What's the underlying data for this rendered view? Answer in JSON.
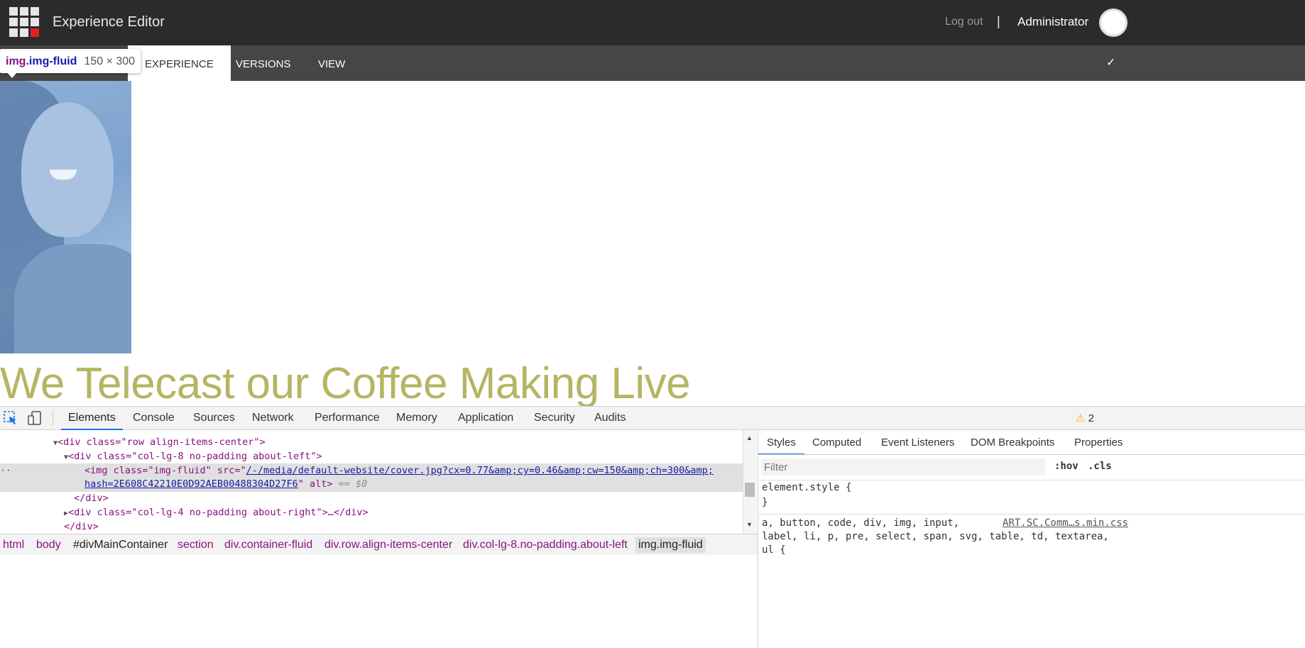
{
  "topbar": {
    "title": "Experience Editor",
    "logout": "Log out",
    "separator": "|",
    "user": "Administrator"
  },
  "ribbon": {
    "tabs": [
      {
        "label": "EXPERIENCE"
      },
      {
        "label": "VERSIONS"
      },
      {
        "label": "VIEW"
      }
    ]
  },
  "inspector_tip": {
    "selector_tag": "img",
    "selector_class": ".img-fluid",
    "dimensions": "150 × 300"
  },
  "page": {
    "headline": "We Telecast our Coffee Making Live"
  },
  "devtools": {
    "tabs": [
      "Elements",
      "Console",
      "Sources",
      "Network",
      "Performance",
      "Memory",
      "Application",
      "Security",
      "Audits"
    ],
    "warnings": "2",
    "dom": {
      "row_div": "<div class=\"row align-items-center\">",
      "col8_open": "<div class=\"col-lg-8 no-padding about-left\">",
      "img_tag_open": "<img class=\"img-fluid\" src=\"",
      "img_src": "/-/media/default-website/cover.jpg?cx=0.77&amp;cy=0.46&amp;cw=150&amp;ch=300&amp;",
      "img_src2": "hash=2E608C42210E0D92AEB00488304D27F6",
      "img_tail": "\" alt>",
      "img_eq": "== $0",
      "div_close": "</div>",
      "col4": "<div class=\"col-lg-4 no-padding about-right\">…</div>",
      "div_close2": "</div>"
    },
    "styles_tabs": [
      "Styles",
      "Computed",
      "Event Listeners",
      "DOM Breakpoints",
      "Properties"
    ],
    "filter_placeholder": "Filter",
    "hov": ":hov",
    "cls": ".cls",
    "element_style_open": "element.style {",
    "element_style_close": "}",
    "rule_selector_1": "a, button, code, div, img, input,",
    "rule_selector_2": "label, li, p, pre, select, span, svg, table, td, textarea,",
    "rule_selector_3": "ul {",
    "rule_source": "ART.SC.Comm…s.min.css",
    "breadcrumbs": [
      "html",
      "body",
      "#divMainContainer",
      "section",
      "div.container-fluid",
      "div.row.align-items-center",
      "div.col-lg-8.no-padding.about-left",
      "img.img-fluid"
    ]
  }
}
